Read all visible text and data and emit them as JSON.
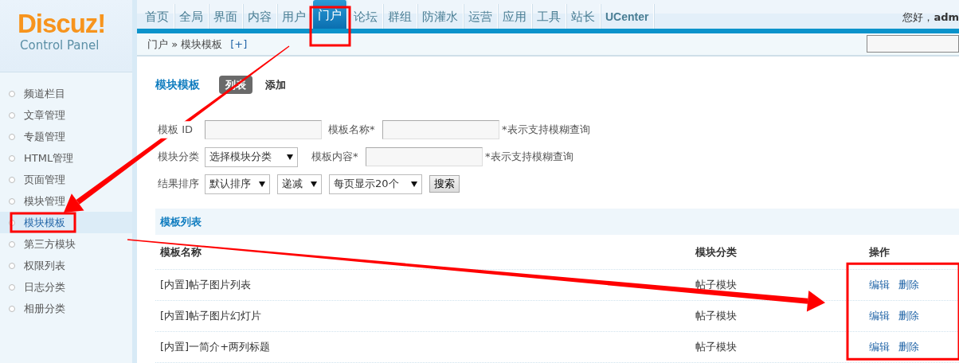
{
  "logo": {
    "name": "Discuz!",
    "subtitle": "Control Panel"
  },
  "nav": [
    {
      "label": "首页",
      "selected": false
    },
    {
      "label": "全局",
      "selected": false
    },
    {
      "label": "界面",
      "selected": false
    },
    {
      "label": "内容",
      "selected": false
    },
    {
      "label": "用户",
      "selected": false
    },
    {
      "label": "门户",
      "selected": true
    },
    {
      "label": "论坛",
      "selected": false
    },
    {
      "label": "群组",
      "selected": false
    },
    {
      "label": "防灌水",
      "selected": false
    },
    {
      "label": "运营",
      "selected": false
    },
    {
      "label": "应用",
      "selected": false
    },
    {
      "label": "工具",
      "selected": false
    },
    {
      "label": "站长",
      "selected": false
    },
    {
      "label": "UCenter",
      "selected": false
    }
  ],
  "greeting": {
    "text": "您好，",
    "user": "adm"
  },
  "breadcrumb": {
    "section": "门户",
    "separator": "»",
    "page": "模块模板",
    "add": "[+]"
  },
  "sidebar": [
    {
      "label": "频道栏目",
      "selected": false
    },
    {
      "label": "文章管理",
      "selected": false
    },
    {
      "label": "专题管理",
      "selected": false
    },
    {
      "label": "HTML管理",
      "selected": false
    },
    {
      "label": "页面管理",
      "selected": false
    },
    {
      "label": "模块管理",
      "selected": false
    },
    {
      "label": "模块模板",
      "selected": true
    },
    {
      "label": "第三方模块",
      "selected": false
    },
    {
      "label": "权限列表",
      "selected": false
    },
    {
      "label": "日志分类",
      "selected": false
    },
    {
      "label": "相册分类",
      "selected": false
    }
  ],
  "page": {
    "title": "模块模板",
    "tabs": [
      {
        "label": "列表",
        "selected": true
      },
      {
        "label": "添加",
        "selected": false
      }
    ]
  },
  "filters": [
    {
      "items": [
        {
          "kind": "label",
          "text": "模板 ID"
        },
        {
          "kind": "input"
        },
        {
          "kind": "label",
          "text": "模板名称*"
        },
        {
          "kind": "input"
        },
        {
          "kind": "hint",
          "text": "*表示支持模糊查询"
        }
      ]
    },
    {
      "items": [
        {
          "kind": "label",
          "text": "模块分类"
        },
        {
          "kind": "select",
          "text": "选择模块分类"
        },
        {
          "kind": "label",
          "text": "模板内容*"
        },
        {
          "kind": "input"
        },
        {
          "kind": "hint",
          "text": "*表示支持模糊查询"
        }
      ]
    },
    {
      "items": [
        {
          "kind": "label",
          "text": "结果排序"
        },
        {
          "kind": "select",
          "text": "默认排序"
        },
        {
          "kind": "select",
          "text": "递减"
        },
        {
          "kind": "select",
          "text": "每页显示20个"
        },
        {
          "kind": "button",
          "text": "搜索"
        }
      ]
    }
  ],
  "list": {
    "title": "模板列表",
    "columns": [
      "模板名称",
      "模块分类",
      "操作"
    ],
    "rows": [
      {
        "name": "[内置]帖子图片列表",
        "category": "帖子模块",
        "actions": [
          "编辑",
          "删除"
        ]
      },
      {
        "name": "[内置]帖子图片幻灯片",
        "category": "帖子模块",
        "actions": [
          "编辑",
          "删除"
        ]
      },
      {
        "name": "[内置]一简介+两列标题",
        "category": "帖子模块",
        "actions": [
          "编辑",
          "删除"
        ]
      }
    ]
  }
}
